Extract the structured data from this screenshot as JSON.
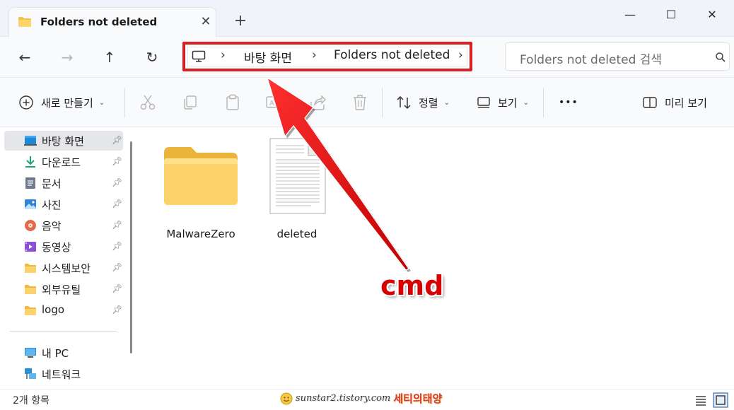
{
  "window": {
    "tab_title": "Folders not deleted",
    "tab_close": "✕",
    "new_tab": "+",
    "minimize": "—",
    "maximize": "☐",
    "close": "✕"
  },
  "nav": {
    "back": "←",
    "forward": "→",
    "up": "↑",
    "refresh": "↻",
    "breadcrumb": [
      "바탕 화면",
      "Folders not deleted"
    ],
    "search_placeholder": "Folders not deleted 검색"
  },
  "toolbar": {
    "new_label": "새로 만들기",
    "sort_label": "정렬",
    "view_label": "보기",
    "more_label": "•••",
    "preview_label": "미리 보기"
  },
  "sidebar": {
    "items": [
      {
        "label": "바탕 화면",
        "icon": "desktop-icon",
        "pinned": true,
        "selected": true
      },
      {
        "label": "다운로드",
        "icon": "download-icon",
        "pinned": true
      },
      {
        "label": "문서",
        "icon": "document-icon",
        "pinned": true
      },
      {
        "label": "사진",
        "icon": "pictures-icon",
        "pinned": true
      },
      {
        "label": "음악",
        "icon": "music-icon",
        "pinned": true
      },
      {
        "label": "동영상",
        "icon": "video-icon",
        "pinned": true
      },
      {
        "label": "시스템보안",
        "icon": "folder-icon",
        "pinned": true
      },
      {
        "label": "외부유틸",
        "icon": "folder-icon",
        "pinned": true
      },
      {
        "label": "logo",
        "icon": "folder-icon",
        "pinned": true
      }
    ],
    "bottom_items": [
      {
        "label": "내 PC",
        "icon": "pc-icon"
      },
      {
        "label": "네트워크",
        "icon": "network-icon"
      }
    ]
  },
  "files": [
    {
      "name": "MalwareZero",
      "type": "folder"
    },
    {
      "name": "deleted",
      "type": "file"
    }
  ],
  "status": {
    "count": "2개 항목",
    "watermark_url": "sunstar2.tistory.com",
    "watermark_name": "세티의태양"
  },
  "annotation": {
    "label": "cmd",
    "color": "#d80000"
  }
}
